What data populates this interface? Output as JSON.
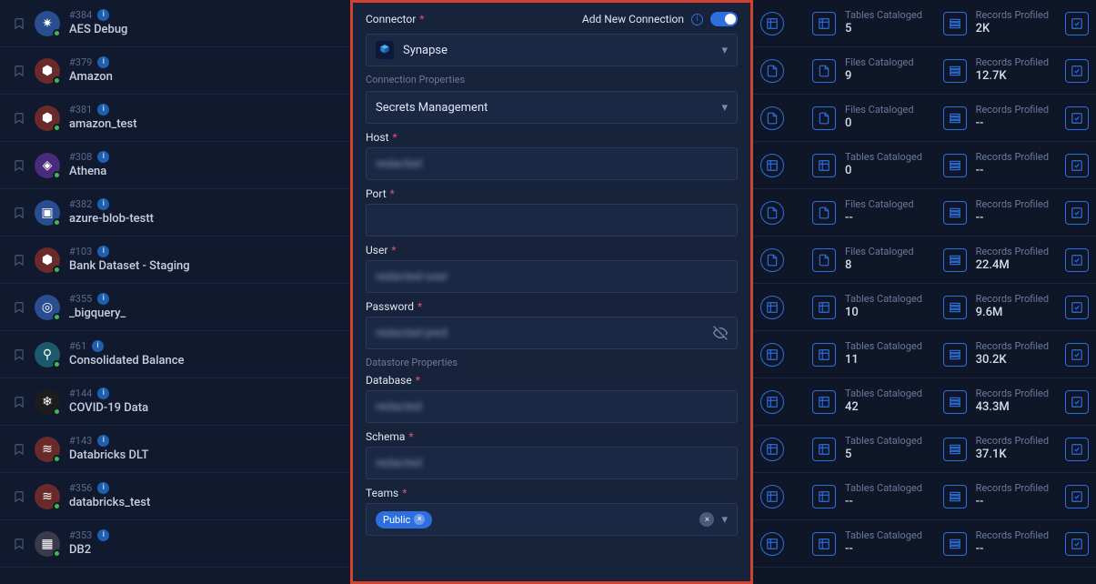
{
  "sidebar": {
    "items": [
      {
        "id": "#384",
        "name": "AES Debug",
        "iconColor": "blue",
        "glyph": "✷"
      },
      {
        "id": "#379",
        "name": "Amazon",
        "iconColor": "red",
        "glyph": "⬢"
      },
      {
        "id": "#381",
        "name": "amazon_test",
        "iconColor": "red",
        "glyph": "⬢"
      },
      {
        "id": "#308",
        "name": "Athena",
        "iconColor": "purple",
        "glyph": "◈"
      },
      {
        "id": "#382",
        "name": "azure-blob-testt",
        "iconColor": "blue",
        "glyph": "▣"
      },
      {
        "id": "#103",
        "name": "Bank Dataset - Staging",
        "iconColor": "red",
        "glyph": "⬢"
      },
      {
        "id": "#355",
        "name": "_bigquery_",
        "iconColor": "blue",
        "glyph": "◎"
      },
      {
        "id": "#61",
        "name": "Consolidated Balance",
        "iconColor": "teal",
        "glyph": "⚲"
      },
      {
        "id": "#144",
        "name": "COVID-19 Data",
        "iconColor": "dark",
        "glyph": "❄"
      },
      {
        "id": "#143",
        "name": "Databricks DLT",
        "iconColor": "red",
        "glyph": "≋"
      },
      {
        "id": "#356",
        "name": "databricks_test",
        "iconColor": "red",
        "glyph": "≋"
      },
      {
        "id": "#353",
        "name": "DB2",
        "iconColor": "gray",
        "glyph": "▦"
      }
    ]
  },
  "modal": {
    "connector_label": "Connector",
    "add_new_label": "Add New Connection",
    "connector_value": "Synapse",
    "conn_props_label": "Connection Properties",
    "secrets_label": "Secrets Management",
    "host_label": "Host",
    "port_label": "Port",
    "user_label": "User",
    "password_label": "Password",
    "ds_props_label": "Datastore Properties",
    "database_label": "Database",
    "schema_label": "Schema",
    "teams_label": "Teams",
    "team_chip": "Public",
    "host_value": "redacted",
    "port_value": "",
    "user_value": "redacted-user",
    "password_value": "redacted-pwd",
    "database_value": "redacted",
    "schema_value": "redacted"
  },
  "stats": {
    "rows": [
      {
        "catIcon": "table",
        "catLabel": "Tables Cataloged",
        "catValue": "5",
        "recLabel": "Records Profiled",
        "recValue": "2K"
      },
      {
        "catIcon": "file",
        "catLabel": "Files Cataloged",
        "catValue": "9",
        "recLabel": "Records Profiled",
        "recValue": "12.7K"
      },
      {
        "catIcon": "file",
        "catLabel": "Files Cataloged",
        "catValue": "0",
        "recLabel": "Records Profiled",
        "recValue": "--"
      },
      {
        "catIcon": "table",
        "catLabel": "Tables Cataloged",
        "catValue": "0",
        "recLabel": "Records Profiled",
        "recValue": "--"
      },
      {
        "catIcon": "file",
        "catLabel": "Files Cataloged",
        "catValue": "--",
        "recLabel": "Records Profiled",
        "recValue": "--"
      },
      {
        "catIcon": "file",
        "catLabel": "Files Cataloged",
        "catValue": "8",
        "recLabel": "Records Profiled",
        "recValue": "22.4M"
      },
      {
        "catIcon": "table",
        "catLabel": "Tables Cataloged",
        "catValue": "10",
        "recLabel": "Records Profiled",
        "recValue": "9.6M"
      },
      {
        "catIcon": "table",
        "catLabel": "Tables Cataloged",
        "catValue": "11",
        "recLabel": "Records Profiled",
        "recValue": "30.2K"
      },
      {
        "catIcon": "table",
        "catLabel": "Tables Cataloged",
        "catValue": "42",
        "recLabel": "Records Profiled",
        "recValue": "43.3M"
      },
      {
        "catIcon": "table",
        "catLabel": "Tables Cataloged",
        "catValue": "5",
        "recLabel": "Records Profiled",
        "recValue": "37.1K"
      },
      {
        "catIcon": "table",
        "catLabel": "Tables Cataloged",
        "catValue": "--",
        "recLabel": "Records Profiled",
        "recValue": "--"
      },
      {
        "catIcon": "table",
        "catLabel": "Tables Cataloged",
        "catValue": "--",
        "recLabel": "Records Profiled",
        "recValue": "--"
      }
    ]
  }
}
